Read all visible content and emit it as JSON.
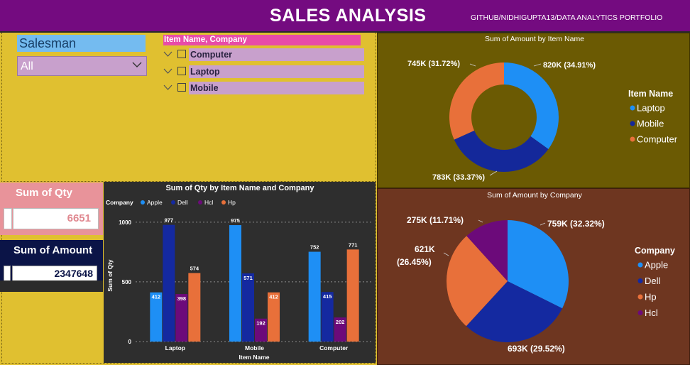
{
  "header": {
    "title": "SALES ANALYSIS",
    "credit": "GITHUB/NIDHIGUPTA13/DATA ANALYTICS PORTFOLIO"
  },
  "salesman_slicer": {
    "label": "Salesman",
    "selected": "All"
  },
  "item_slicer": {
    "header": "Item Name, Company",
    "items": [
      "Computer",
      "Laptop",
      "Mobile"
    ]
  },
  "cards": {
    "qty": {
      "label": "Sum of Qty",
      "value": "6651"
    },
    "amount": {
      "label": "Sum of Amount",
      "value": "2347648"
    }
  },
  "colors": {
    "apple": "#1e8ff5",
    "dell": "#1429a0",
    "hcl": "#6c0a7a",
    "hp": "#e8703a",
    "laptop": "#1e8ff5",
    "mobile": "#14289a",
    "computer": "#e8703a"
  },
  "chart_data": [
    {
      "type": "bar",
      "title": "Sum of Qty by Item Name and Company",
      "xlabel": "Item Name",
      "ylabel": "Sum of Qty",
      "legend_title": "Company",
      "legend_position": "top-left",
      "categories": [
        "Laptop",
        "Mobile",
        "Computer"
      ],
      "series": [
        {
          "name": "Apple",
          "values": [
            412,
            975,
            752
          ]
        },
        {
          "name": "Dell",
          "values": [
            977,
            571,
            415
          ]
        },
        {
          "name": "Hcl",
          "values": [
            398,
            192,
            202
          ]
        },
        {
          "name": "Hp",
          "values": [
            574,
            412,
            771
          ]
        }
      ],
      "yticks": [
        "0",
        "500",
        "1000"
      ],
      "ylim": [
        0,
        1100
      ],
      "grid": true
    },
    {
      "type": "pie",
      "variant": "donut",
      "title": "Sum of Amount by Item Name",
      "legend_title": "Item Name",
      "legend_position": "right",
      "slices": [
        {
          "name": "Laptop",
          "value": 820,
          "label": "820K (34.91%)"
        },
        {
          "name": "Mobile",
          "value": 783,
          "label": "783K (33.37%)"
        },
        {
          "name": "Computer",
          "value": 745,
          "label": "745K (31.72%)"
        }
      ]
    },
    {
      "type": "pie",
      "title": "Sum of Amount by Company",
      "legend_title": "Company",
      "legend_position": "right",
      "slices": [
        {
          "name": "Apple",
          "value": 759,
          "label": "759K (32.32%)"
        },
        {
          "name": "Dell",
          "value": 693,
          "label": "693K (29.52%)"
        },
        {
          "name": "Hp",
          "value": 621,
          "label": "621K (26.45%)"
        },
        {
          "name": "Hcl",
          "value": 275,
          "label": "275K (11.71%)"
        }
      ],
      "legend_order": [
        "Apple",
        "Dell",
        "Hp",
        "Hcl"
      ]
    }
  ]
}
